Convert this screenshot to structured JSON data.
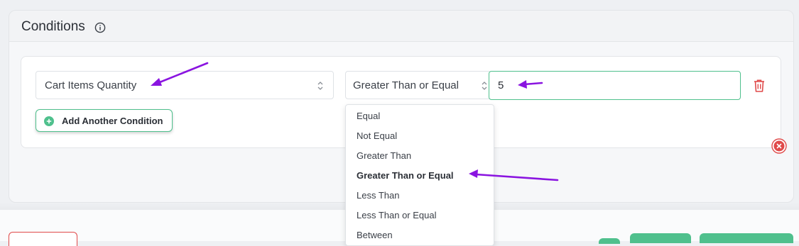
{
  "conditions": {
    "title": "Conditions",
    "info_icon": "info-circle-icon",
    "field_select": {
      "value": "Cart Items Quantity"
    },
    "operator_select": {
      "value": "Greater Than or Equal"
    },
    "value_input": {
      "value": "5"
    },
    "delete_icon": "trash-icon",
    "add_button": {
      "label": "Add Another Condition",
      "icon": "plus-circle-icon"
    },
    "remove_icon": "close-circle-icon",
    "operator_options": [
      "Equal",
      "Not Equal",
      "Greater Than",
      "Greater Than or Equal",
      "Less Than",
      "Less Than or Equal",
      "Between"
    ],
    "selected_option": "Greater Than or Equal"
  },
  "colors": {
    "accent_green": "#4fc08d",
    "danger_red": "#e04a4a",
    "annotation_purple": "#8a14e0"
  }
}
